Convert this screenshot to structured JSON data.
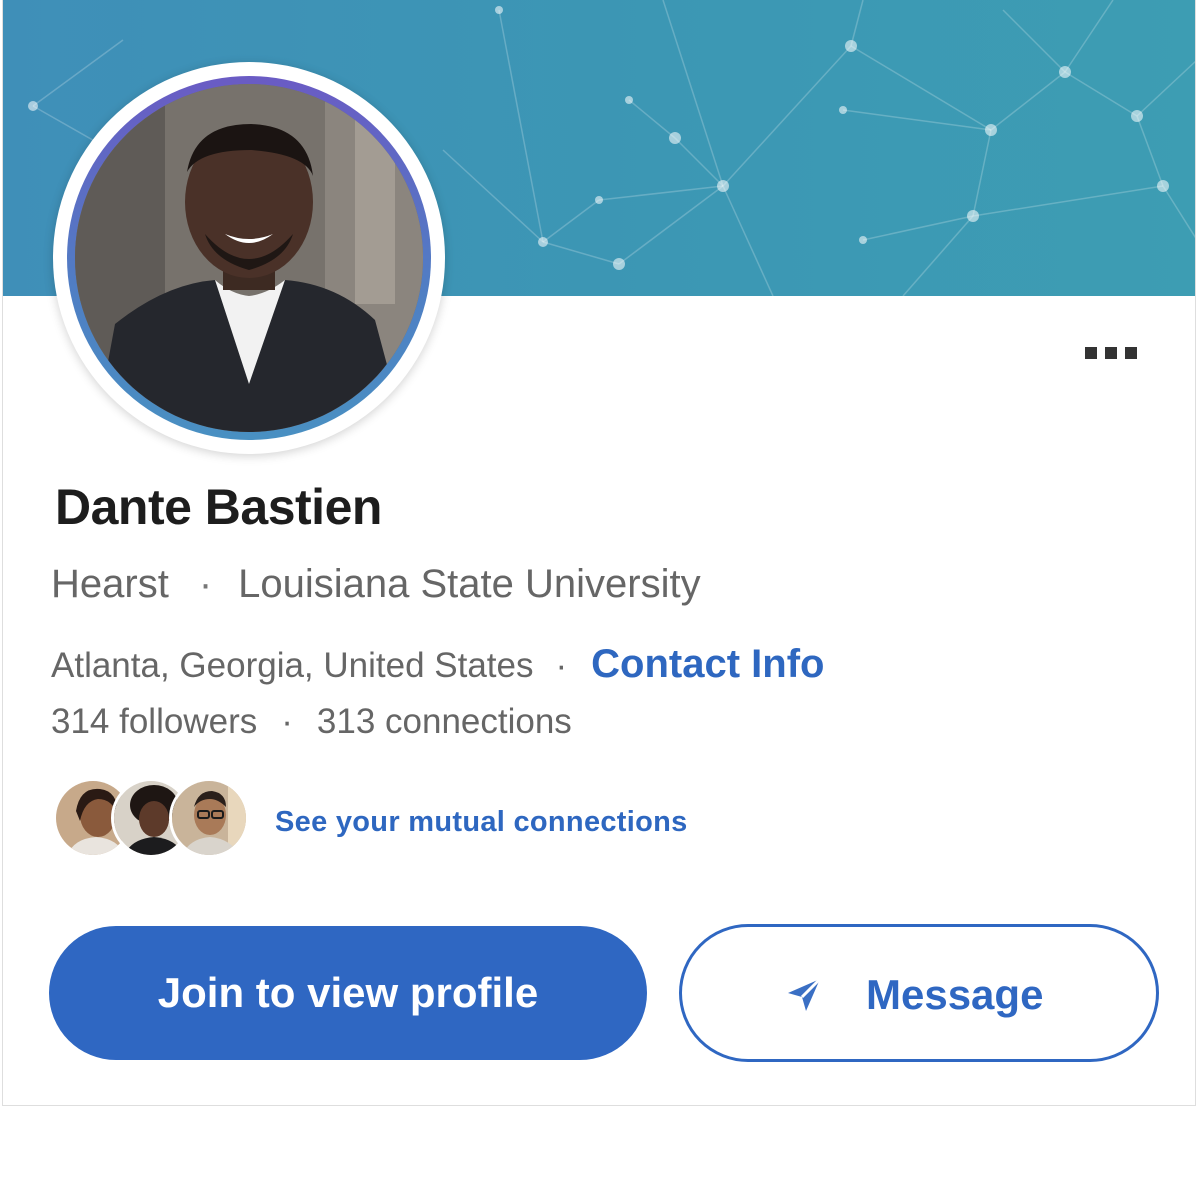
{
  "profile": {
    "name": "Dante Bastien",
    "company": "Hearst",
    "separator": "·",
    "school": "Louisiana State University",
    "location": "Atlanta, Georgia, United States",
    "contact_label": "Contact Info",
    "followers": "314 followers",
    "connections": "313 connections"
  },
  "mutual": {
    "link_label": "See your mutual connections"
  },
  "actions": {
    "join_label": "Join to view profile",
    "message_label": "Message"
  },
  "icons": {
    "more": "more-icon",
    "send": "send-icon"
  },
  "colors": {
    "accent": "#2f67c2",
    "cover": "#3c97b4",
    "text_secondary": "#666666"
  }
}
